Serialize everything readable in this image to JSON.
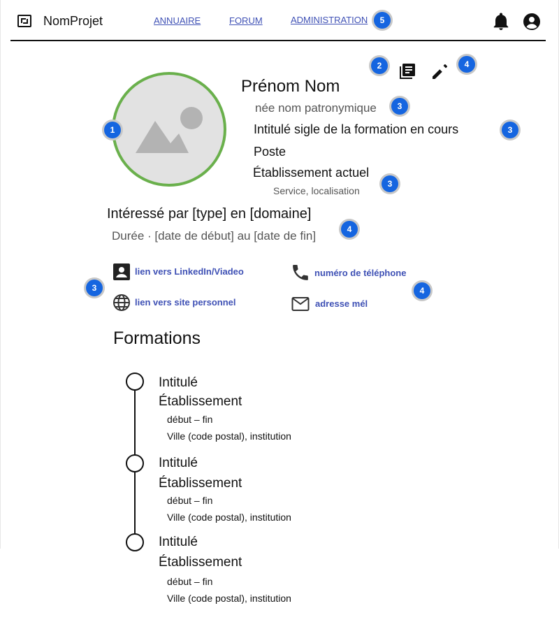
{
  "header": {
    "app_title": "NomProjet",
    "nav": [
      "ANNUAIRE",
      "FORUM",
      "ADMINISTRATION"
    ],
    "icons": [
      "logo-icon",
      "bell-icon",
      "account-circle-icon"
    ]
  },
  "badges": {
    "nav_admin": "5",
    "toolbar_doc": "2",
    "toolbar_edit": "4",
    "avatar": "1",
    "birth_name": "3",
    "formation": "3",
    "etab": "3",
    "interest": "4",
    "links": "3",
    "contact": "4"
  },
  "profile": {
    "name": "Prénom Nom",
    "birth_name": "née nom patronymique",
    "formation": "Intitulé sigle de la formation en cours",
    "poste": "Poste",
    "etablissement": "Établissement actuel",
    "service": "Service, localisation",
    "interest": "Intéressé par [type] en [domaine]",
    "duration": "Durée · [date de début] au [date de fin]"
  },
  "links": {
    "linkedin": "lien vers LinkedIn/Viadeo",
    "website": "lien vers site personnel",
    "phone": "numéro de téléphone",
    "email": "adresse mél"
  },
  "formations_title": "Formations",
  "formations": [
    {
      "title": "Intitulé",
      "etab": "Établissement",
      "dates": "début – fin",
      "place": "Ville (code postal), institution"
    },
    {
      "title": "Intitulé",
      "etab": "Établissement",
      "dates": "début – fin",
      "place": "Ville (code postal), institution"
    },
    {
      "title": "Intitulé",
      "etab": "Établissement",
      "dates": "début – fin",
      "place": "Ville (code postal), institution"
    }
  ],
  "colors": {
    "accent_link": "#3f51b5",
    "avatar_ring": "#6ab04c",
    "badge": "#1565e0"
  }
}
